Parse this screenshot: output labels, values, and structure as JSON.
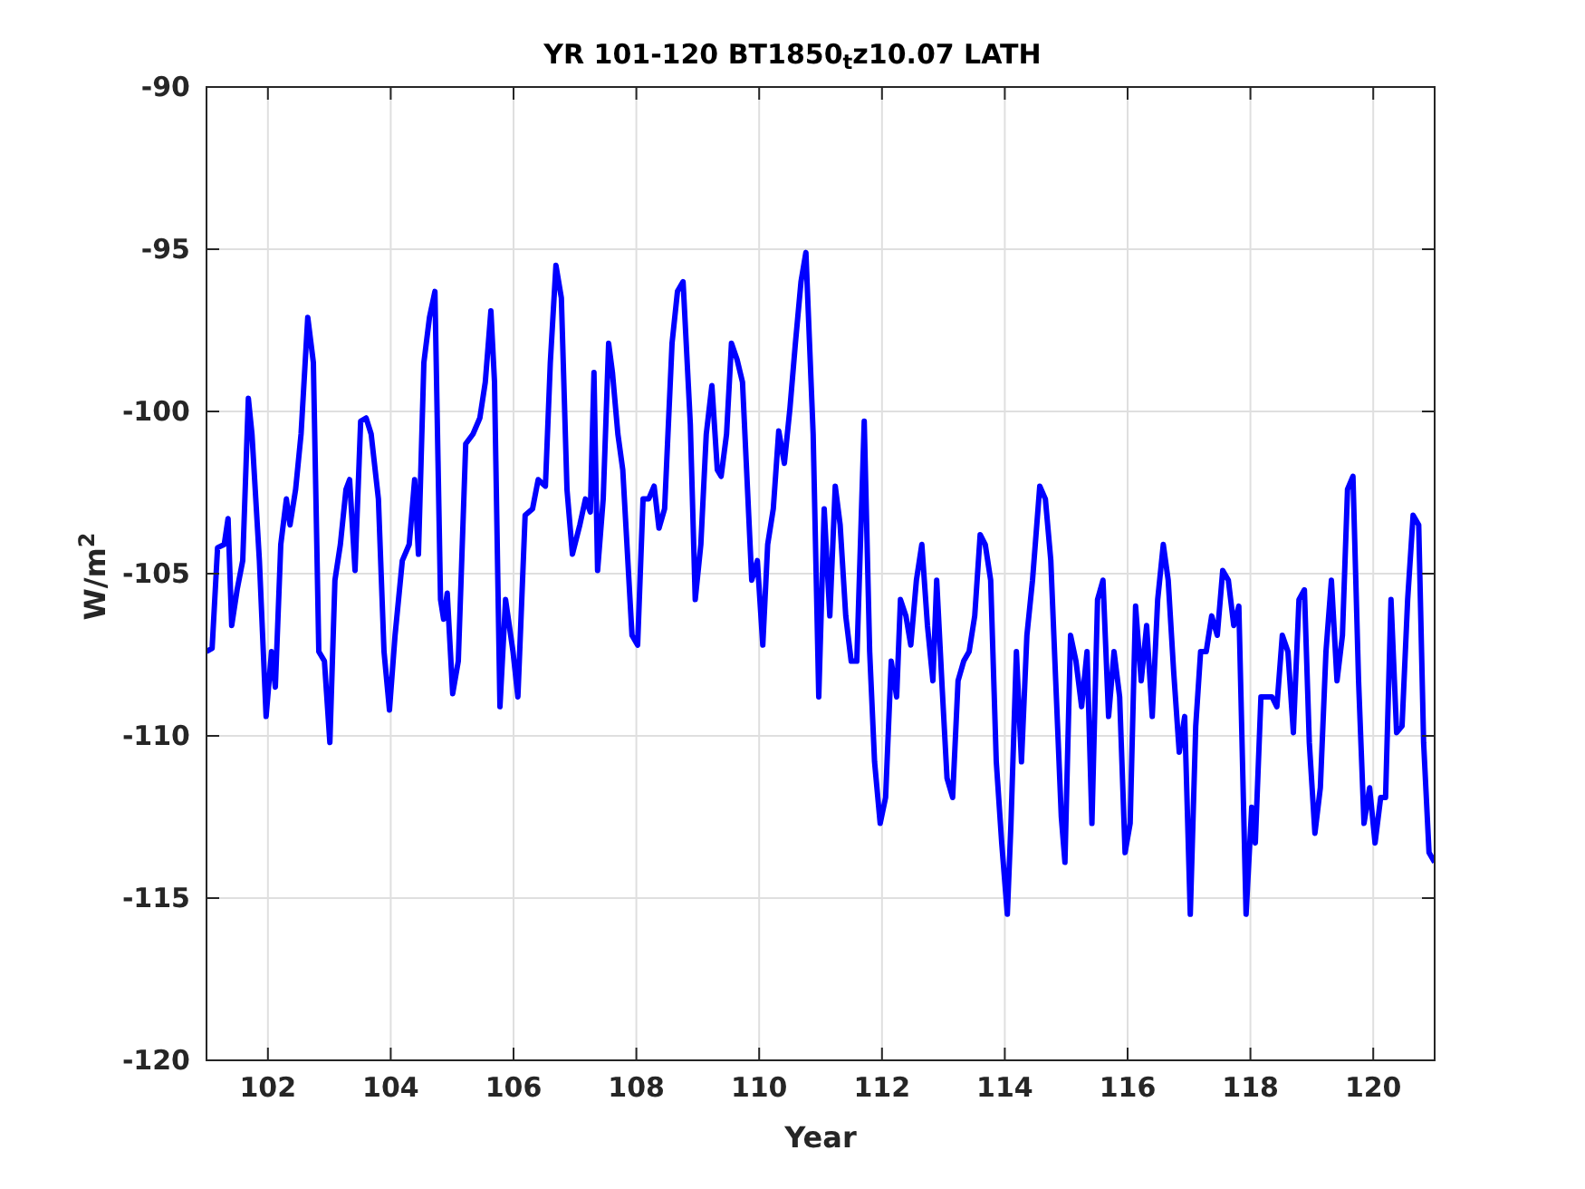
{
  "figure": {
    "chart_data": {
      "type": "line",
      "title": "YR 101-120 BT1850$_{t}$z10.07 LATH",
      "xlabel": "Year",
      "ylabel": "W/m$^{2}$",
      "grid": true,
      "xlim": [
        101,
        121
      ],
      "ylim": [
        -120,
        -90
      ],
      "xticks": [
        102,
        104,
        106,
        108,
        110,
        112,
        114,
        116,
        118,
        120
      ],
      "yticks": [
        -120,
        -115,
        -110,
        -105,
        -100,
        -95,
        -90
      ],
      "x": [
        101.0,
        101.09,
        101.18,
        101.29,
        101.35,
        101.41,
        101.5,
        101.59,
        101.68,
        101.74,
        101.86,
        101.97,
        102.06,
        102.12,
        102.21,
        102.3,
        102.36,
        102.45,
        102.54,
        102.65,
        102.74,
        102.83,
        102.92,
        103.01,
        103.09,
        103.18,
        103.27,
        103.33,
        103.42,
        103.51,
        103.6,
        103.68,
        103.8,
        103.89,
        103.98,
        104.07,
        104.19,
        104.3,
        104.39,
        104.45,
        104.54,
        104.63,
        104.72,
        104.81,
        104.86,
        104.92,
        105.01,
        105.1,
        105.22,
        105.34,
        105.45,
        105.54,
        105.63,
        105.69,
        105.78,
        105.87,
        105.99,
        106.07,
        106.19,
        106.31,
        106.4,
        106.52,
        106.6,
        106.69,
        106.78,
        106.87,
        106.96,
        107.08,
        107.17,
        107.25,
        107.31,
        107.37,
        107.46,
        107.55,
        107.61,
        107.7,
        107.78,
        107.93,
        108.02,
        108.11,
        108.2,
        108.29,
        108.37,
        108.46,
        108.58,
        108.67,
        108.76,
        108.88,
        108.96,
        109.05,
        109.14,
        109.23,
        109.32,
        109.38,
        109.47,
        109.55,
        109.64,
        109.73,
        109.88,
        109.97,
        110.06,
        110.14,
        110.23,
        110.32,
        110.41,
        110.5,
        110.59,
        110.68,
        110.76,
        110.88,
        110.97,
        111.06,
        111.15,
        111.24,
        111.32,
        111.41,
        111.5,
        111.59,
        111.71,
        111.8,
        111.88,
        111.97,
        112.06,
        112.15,
        112.24,
        112.3,
        112.39,
        112.47,
        112.56,
        112.65,
        112.74,
        112.83,
        112.89,
        112.98,
        113.06,
        113.15,
        113.24,
        113.33,
        113.42,
        113.51,
        113.6,
        113.68,
        113.77,
        113.86,
        113.95,
        114.04,
        114.1,
        114.19,
        114.27,
        114.36,
        114.45,
        114.57,
        114.66,
        114.75,
        114.83,
        114.92,
        114.98,
        115.07,
        115.16,
        115.25,
        115.34,
        115.42,
        115.51,
        115.6,
        115.69,
        115.78,
        115.87,
        115.96,
        116.04,
        116.13,
        116.22,
        116.31,
        116.4,
        116.49,
        116.58,
        116.66,
        116.75,
        116.84,
        116.93,
        117.02,
        117.11,
        117.19,
        117.28,
        117.37,
        117.46,
        117.55,
        117.64,
        117.73,
        117.81,
        117.93,
        118.02,
        118.08,
        118.17,
        118.26,
        118.35,
        118.43,
        118.52,
        118.61,
        118.7,
        118.79,
        118.88,
        118.96,
        119.05,
        119.14,
        119.23,
        119.32,
        119.41,
        119.5,
        119.58,
        119.67,
        119.76,
        119.85,
        119.94,
        120.03,
        120.12,
        120.2,
        120.29,
        120.38,
        120.47,
        120.56,
        120.65,
        120.74,
        120.82,
        120.91,
        121.0
      ],
      "series": [
        {
          "color": "#0000ff",
          "values": [
            -107.4,
            -107.3,
            -104.2,
            -104.1,
            -103.3,
            -106.6,
            -105.5,
            -104.6,
            -99.6,
            -100.7,
            -104.6,
            -109.4,
            -107.4,
            -108.5,
            -104.1,
            -102.7,
            -103.5,
            -102.4,
            -100.7,
            -97.1,
            -98.5,
            -107.4,
            -107.7,
            -110.2,
            -105.2,
            -104.1,
            -102.4,
            -102.1,
            -104.9,
            -100.3,
            -100.2,
            -100.7,
            -102.7,
            -107.4,
            -109.2,
            -106.9,
            -104.6,
            -104.1,
            -102.1,
            -104.4,
            -98.5,
            -97.1,
            -96.3,
            -105.8,
            -106.4,
            -105.6,
            -108.7,
            -107.7,
            -101.0,
            -100.7,
            -100.2,
            -99.1,
            -96.9,
            -99.1,
            -109.1,
            -105.8,
            -107.4,
            -108.8,
            -103.2,
            -103.0,
            -102.1,
            -102.3,
            -98.5,
            -95.5,
            -96.5,
            -102.4,
            -104.4,
            -103.5,
            -102.7,
            -103.1,
            -98.8,
            -104.9,
            -102.7,
            -97.9,
            -98.8,
            -100.7,
            -101.8,
            -106.9,
            -107.2,
            -102.7,
            -102.7,
            -102.3,
            -103.6,
            -103.0,
            -97.9,
            -96.3,
            -96.0,
            -100.4,
            -105.8,
            -104.1,
            -100.7,
            -99.2,
            -101.8,
            -102.0,
            -100.7,
            -97.9,
            -98.4,
            -99.1,
            -105.2,
            -104.6,
            -107.2,
            -104.1,
            -103.0,
            -100.6,
            -101.6,
            -99.9,
            -97.9,
            -96.0,
            -95.1,
            -100.7,
            -108.8,
            -103.0,
            -106.3,
            -102.3,
            -103.5,
            -106.3,
            -107.7,
            -107.7,
            -100.3,
            -107.4,
            -110.8,
            -112.7,
            -111.9,
            -107.7,
            -108.8,
            -105.8,
            -106.3,
            -107.2,
            -105.2,
            -104.1,
            -106.6,
            -108.3,
            -105.2,
            -108.5,
            -111.3,
            -111.9,
            -108.3,
            -107.7,
            -107.4,
            -106.3,
            -103.8,
            -104.1,
            -105.2,
            -110.8,
            -113.3,
            -115.5,
            -112.7,
            -107.4,
            -110.8,
            -106.9,
            -105.2,
            -102.3,
            -102.7,
            -104.6,
            -108.3,
            -112.5,
            -113.9,
            -106.9,
            -107.7,
            -109.1,
            -107.4,
            -112.7,
            -105.8,
            -105.2,
            -109.4,
            -107.4,
            -108.8,
            -113.6,
            -112.7,
            -106.0,
            -108.3,
            -106.6,
            -109.4,
            -105.8,
            -104.1,
            -105.2,
            -108.0,
            -110.5,
            -109.4,
            -115.5,
            -109.7,
            -107.4,
            -107.4,
            -106.3,
            -106.9,
            -104.9,
            -105.2,
            -106.6,
            -106.0,
            -115.5,
            -112.2,
            -113.3,
            -108.8,
            -108.8,
            -108.8,
            -109.1,
            -106.9,
            -107.4,
            -109.9,
            -105.8,
            -105.5,
            -110.2,
            -113.0,
            -111.6,
            -107.4,
            -105.2,
            -108.3,
            -106.9,
            -102.4,
            -102.0,
            -108.3,
            -112.7,
            -111.6,
            -113.3,
            -111.9,
            -111.9,
            -105.8,
            -109.9,
            -109.7,
            -105.8,
            -103.2,
            -103.5,
            -110.2,
            -113.6,
            -113.9
          ]
        }
      ]
    }
  }
}
